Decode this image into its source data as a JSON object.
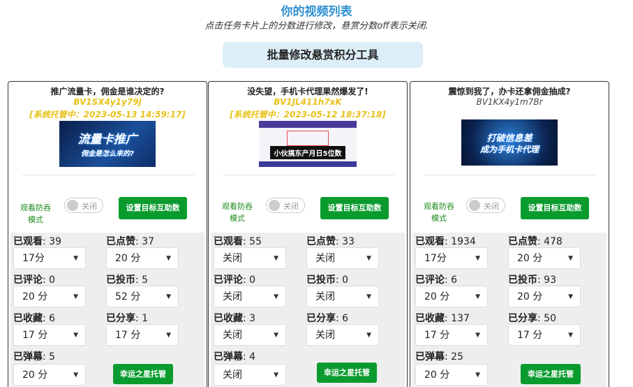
{
  "header": {
    "title": "你的视频列表",
    "subtitle": "点击任务卡片上的分数进行修改，悬赏分数off表示关闭.",
    "tool_button": "批量修改悬赏积分工具"
  },
  "labels": {
    "fang_line1": "观看防吞",
    "fang_line2": "模式",
    "toggle_off": "关闭",
    "set_target": "设置目标互助数",
    "lucky": "幸运之星托管",
    "view": "已观看",
    "like": "已点赞",
    "comment": "已评论",
    "coin": "已投币",
    "fav": "已收藏",
    "share": "已分享",
    "danmu": "已弹幕"
  },
  "cards": [
    {
      "title": "推广流量卡，佣金是谁决定的?",
      "bvid": "BV1SX4y1y79j",
      "status": "[系统托管中：2023-05-13 14:59:17]",
      "cover_text1": "流量卡推广",
      "cover_text2": "佣金是怎么来的?",
      "view": ": 39",
      "like": ": 37",
      "comment": ": 0",
      "coin": ": 5",
      "fav": ": 6",
      "share": ": 1",
      "danmu": ": 5",
      "view_sel": "17分",
      "like_sel": "20 分",
      "comment_sel": "20 分",
      "coin_sel": "52 分",
      "fav_sel": "17 分",
      "share_sel": "17 分",
      "danmu_sel": "20 分"
    },
    {
      "title": "没失望，手机卡代理果然爆发了!",
      "bvid": "BV1JL411h7xK",
      "status": "[系统托管中：2023-05-12 18:37:18]",
      "cover_text1": "小伙搞东产月日5位数",
      "view": ": 55",
      "like": ": 33",
      "comment": ": 0",
      "coin": ": 0",
      "fav": ": 3",
      "share": ": 6",
      "danmu": ": 4",
      "view_sel": "关闭",
      "like_sel": "关闭",
      "comment_sel": "关闭",
      "coin_sel": "关闭",
      "fav_sel": "关闭",
      "share_sel": "关闭",
      "danmu_sel": "关闭"
    },
    {
      "title": "震惊到我了，办卡还拿佣金抽成?",
      "bvid": "BV1KX4y1m7Br",
      "cover_text1": "打破信息差",
      "cover_text2": "成为手机卡代理",
      "view": ": 1934",
      "like": ": 478",
      "comment": ": 6",
      "coin": ": 93",
      "fav": ": 137",
      "share": ": 50",
      "danmu": ": 25",
      "view_sel": "17分",
      "like_sel": "20 分",
      "comment_sel": "20 分",
      "coin_sel": "20 分",
      "fav_sel": "17 分",
      "share_sel": "17 分",
      "danmu_sel": "20 分"
    }
  ],
  "colors": {
    "title_blue": "#2e8fd1",
    "status_yellow": "#e8c21a",
    "green": "#0a9b2e"
  }
}
